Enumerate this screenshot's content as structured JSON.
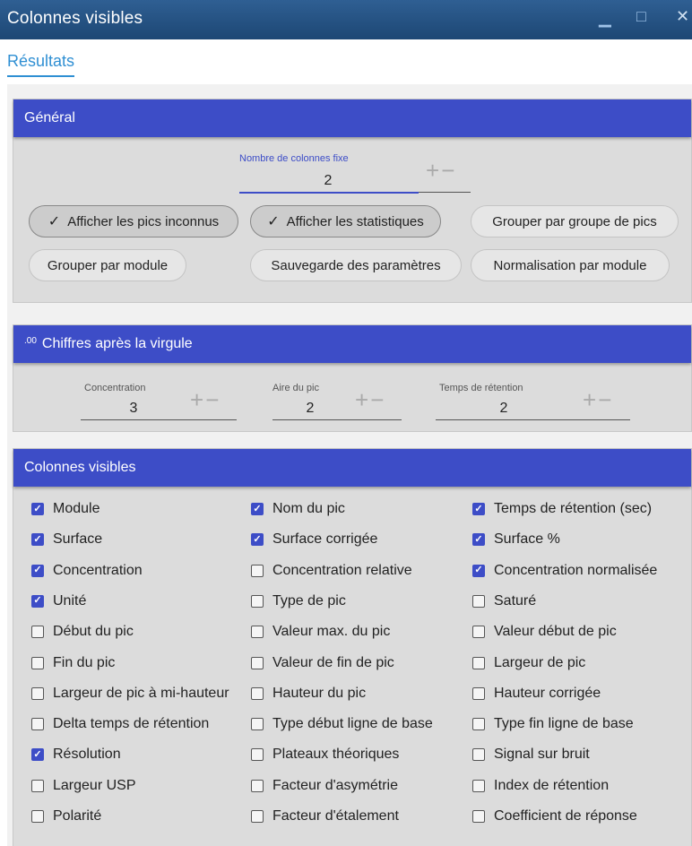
{
  "window": {
    "title": "Colonnes visibles",
    "minimize_icon": "minimize-icon",
    "maximize_icon": "maximize-icon",
    "close_icon": "close-icon"
  },
  "tabs": [
    {
      "label": "Résultats",
      "active": true
    }
  ],
  "general": {
    "title": "Général",
    "fixed_columns": {
      "label": "Nombre de colonnes fixe",
      "value": "2"
    },
    "options": [
      {
        "label": "Afficher les pics inconnus",
        "selected": true
      },
      {
        "label": "Afficher les statistiques",
        "selected": true
      },
      {
        "label": "Grouper par groupe de pics",
        "selected": false
      },
      {
        "label": "Grouper par module",
        "selected": false
      },
      {
        "label": "Sauvegarde des paramètres",
        "selected": false
      },
      {
        "label": "Normalisation par module",
        "selected": false
      }
    ]
  },
  "decimals": {
    "title": "Chiffres après la virgule",
    "icon": ".00",
    "fields": [
      {
        "label": "Concentration",
        "value": "3"
      },
      {
        "label": "Aire du pic",
        "value": "2"
      },
      {
        "label": "Temps de rétention",
        "value": "2"
      }
    ]
  },
  "visible_columns": {
    "title": "Colonnes visibles",
    "items": [
      {
        "label": "Module",
        "checked": true
      },
      {
        "label": "Nom du pic",
        "checked": true
      },
      {
        "label": "Temps de rétention (sec)",
        "checked": true
      },
      {
        "label": "Surface",
        "checked": true
      },
      {
        "label": "Surface corrigée",
        "checked": true
      },
      {
        "label": "Surface %",
        "checked": true
      },
      {
        "label": "Concentration",
        "checked": true
      },
      {
        "label": "Concentration relative",
        "checked": false
      },
      {
        "label": "Concentration normalisée",
        "checked": true
      },
      {
        "label": "Unité",
        "checked": true
      },
      {
        "label": "Type de pic",
        "checked": false
      },
      {
        "label": "Saturé",
        "checked": false
      },
      {
        "label": "Début du pic",
        "checked": false
      },
      {
        "label": "Valeur max. du pic",
        "checked": false
      },
      {
        "label": "Valeur début de pic",
        "checked": false
      },
      {
        "label": "Fin du pic",
        "checked": false
      },
      {
        "label": "Valeur de fin de pic",
        "checked": false
      },
      {
        "label": "Largeur de pic",
        "checked": false
      },
      {
        "label": "Largeur de pic à mi-hauteur",
        "checked": false
      },
      {
        "label": "Hauteur du pic",
        "checked": false
      },
      {
        "label": "Hauteur corrigée",
        "checked": false
      },
      {
        "label": "Delta temps de rétention",
        "checked": false
      },
      {
        "label": "Type début ligne de base",
        "checked": false
      },
      {
        "label": "Type fin ligne de base",
        "checked": false
      },
      {
        "label": "Résolution",
        "checked": true
      },
      {
        "label": "Plateaux théoriques",
        "checked": false
      },
      {
        "label": "Signal sur bruit",
        "checked": false
      },
      {
        "label": "Largeur USP",
        "checked": false
      },
      {
        "label": "Facteur d'asymétrie",
        "checked": false
      },
      {
        "label": "Index de rétention",
        "checked": false
      },
      {
        "label": "Polarité",
        "checked": false
      },
      {
        "label": "Facteur d'étalement",
        "checked": false
      },
      {
        "label": "Coefficient de réponse",
        "checked": false
      }
    ]
  },
  "stepper": {
    "plus": "+",
    "minus": "−"
  },
  "colors": {
    "accent": "#3d4dc7",
    "titlebar": "#1d4774",
    "tab": "#2f8fd3"
  }
}
